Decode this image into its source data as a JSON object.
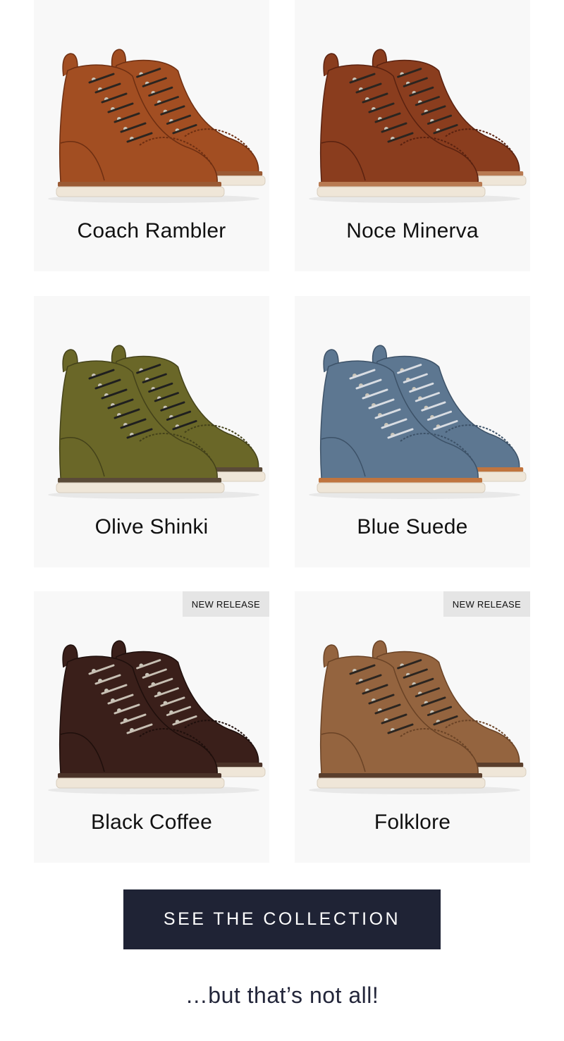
{
  "products": [
    {
      "name": "Coach Rambler",
      "badge": "",
      "colors": {
        "leather": "#a24e22",
        "shade": "#6e2f12",
        "sole": "#efe6d8",
        "welt": "#9a5a34",
        "lace": "#2b2520"
      }
    },
    {
      "name": "Noce Minerva",
      "badge": "",
      "colors": {
        "leather": "#8a3d1e",
        "shade": "#5a2210",
        "sole": "#efe6d8",
        "welt": "#b87a52",
        "lace": "#2b2520"
      }
    },
    {
      "name": "Olive Shinki",
      "badge": "",
      "colors": {
        "leather": "#6a6728",
        "shade": "#44421a",
        "sole": "#efe6d8",
        "welt": "#5a4a38",
        "lace": "#1f1f1f"
      }
    },
    {
      "name": "Blue Suede",
      "badge": "",
      "colors": {
        "leather": "#5d7791",
        "shade": "#3d5268",
        "sole": "#efe6d8",
        "welt": "#c0743e",
        "lace": "#d9dde3"
      }
    },
    {
      "name": "Black Coffee",
      "badge": "NEW RELEASE",
      "colors": {
        "leather": "#3a1f1a",
        "shade": "#1f0f0c",
        "sole": "#efe6d8",
        "welt": "#4a3228",
        "lace": "#c8c0b4"
      }
    },
    {
      "name": "Folklore",
      "badge": "NEW RELEASE",
      "colors": {
        "leather": "#94643f",
        "shade": "#6a4326",
        "sole": "#efe6d8",
        "welt": "#5a3e2c",
        "lace": "#2b2520"
      }
    }
  ],
  "cta": {
    "label": "SEE THE COLLECTION"
  },
  "tagline": "…but that’s not all!"
}
